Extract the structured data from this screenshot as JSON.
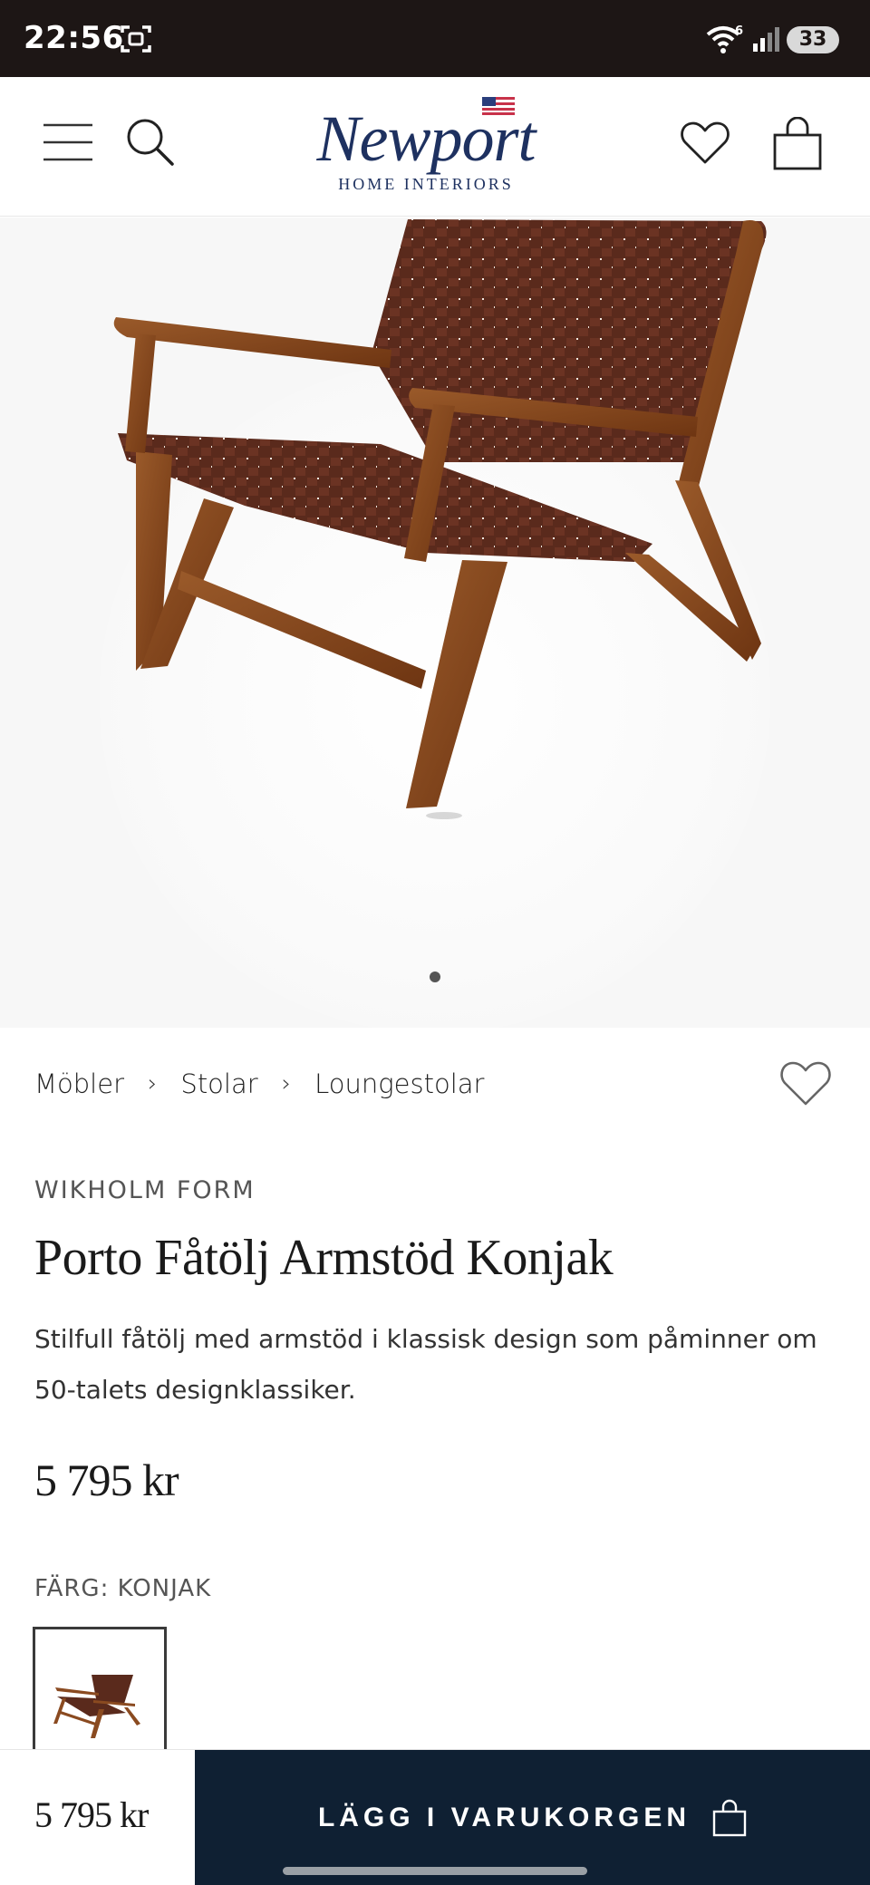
{
  "status_bar": {
    "time": "22:56",
    "wifi_badge": "6",
    "battery": "33"
  },
  "header": {
    "logo_wordmark": "Newport",
    "logo_subtitle": "HOME INTERIORS",
    "icons": [
      "menu-icon",
      "search-icon",
      "heart-icon",
      "shopping-bag-icon",
      "us-flag-icon"
    ]
  },
  "gallery": {
    "image_count": 1,
    "active_index": 0
  },
  "breadcrumb": {
    "items": [
      "Möbler",
      "Stolar",
      "Loungestolar"
    ],
    "separator": "›"
  },
  "product": {
    "brand": "WIKHOLM FORM",
    "title": "Porto Fåtölj Armstöd Konjak",
    "description": "Stilfull fåtölj med armstöd i klassisk design som påminner om 50-talets designklassiker.",
    "price": "5 795 kr",
    "color_label": "FÄRG: KONJAK"
  },
  "sticky_bar": {
    "price": "5 795 kr",
    "add_to_cart_label": "LÄGG I VARUKORGEN"
  },
  "colors": {
    "status_bar_bg": "#1d1615",
    "brand_navy": "#1e3160",
    "cta_bg": "#0f2033",
    "leather": "#5a2a1c",
    "wood": "#8a4a20"
  }
}
